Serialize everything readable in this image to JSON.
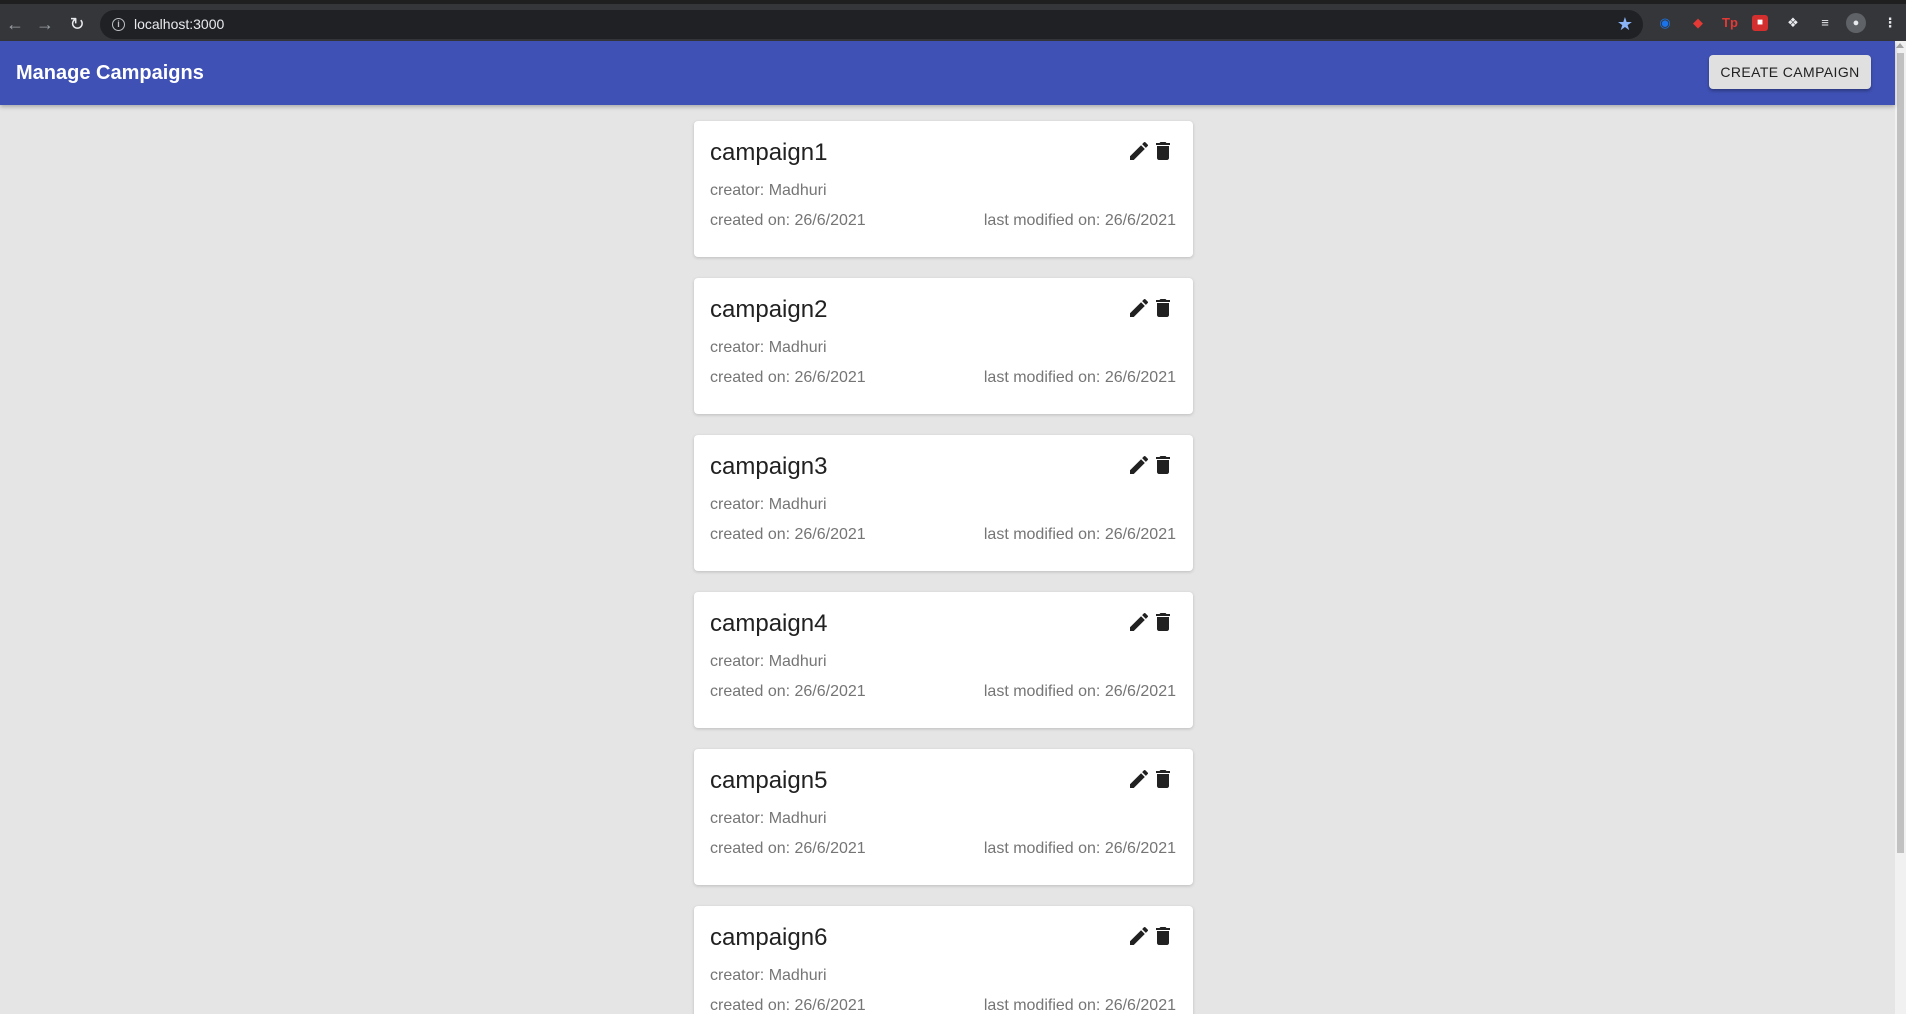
{
  "browser": {
    "url": "localhost:3000",
    "back_icon": "arrow-left-icon",
    "forward_icon": "arrow-right-icon",
    "reload_icon": "reload-icon"
  },
  "header": {
    "title": "Manage Campaigns",
    "create_button": "CREATE CAMPAIGN",
    "color": "#3f51b5"
  },
  "campaigns": [
    {
      "name": "campaign1",
      "creator": "creator: Madhuri",
      "created": "created on: 26/6/2021",
      "modified": "last modified on: 26/6/2021"
    },
    {
      "name": "campaign2",
      "creator": "creator: Madhuri",
      "created": "created on: 26/6/2021",
      "modified": "last modified on: 26/6/2021"
    },
    {
      "name": "campaign3",
      "creator": "creator: Madhuri",
      "created": "created on: 26/6/2021",
      "modified": "last modified on: 26/6/2021"
    },
    {
      "name": "campaign4",
      "creator": "creator: Madhuri",
      "created": "created on: 26/6/2021",
      "modified": "last modified on: 26/6/2021"
    },
    {
      "name": "campaign5",
      "creator": "creator: Madhuri",
      "created": "created on: 26/6/2021",
      "modified": "last modified on: 26/6/2021"
    },
    {
      "name": "campaign6",
      "creator": "creator: Madhuri",
      "created": "created on: 26/6/2021",
      "modified": "last modified on: 26/6/2021"
    }
  ]
}
